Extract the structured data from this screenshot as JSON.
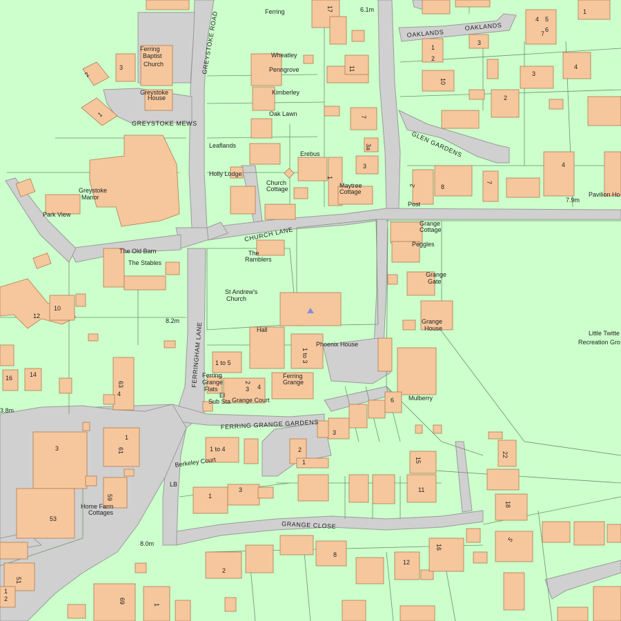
{
  "map": {
    "colors": {
      "land": "#ccffcc",
      "road": "#d0d0d0",
      "road_edge": "#9a9a9a",
      "building": "#f6c79d",
      "building_edge": "#b07a50",
      "boundary": "#6f8f6f",
      "church_marker": "#7f8fe0"
    },
    "roads": {
      "greystoke_road": "GREYSTOKE ROAD",
      "greystoke_mews": "GREYSTOKE MEWS",
      "church_lane": "CHURCH LANE",
      "ferringham_lane": "FERRINGHAM LANE",
      "ferring_grange_gardens": "FERRING GRANGE GARDENS",
      "grange_close": "GRANGE CLOSE",
      "glen_gardens": "GLEN GARDENS",
      "oaklands_1": "OAKLANDS",
      "oaklands_2": "OAKLANDS"
    },
    "places": {
      "ferring": "Ferring",
      "baptist_1": "Ferring",
      "baptist_2": "Baptist",
      "baptist_3": "Church",
      "greystoke_house_1": "Greystoke",
      "greystoke_house_2": "House",
      "wheatley": "Wheatley",
      "penngrove": "Penngrove",
      "kimberley": "Kimberley",
      "oak_lawn": "Oak Lawn",
      "leaflands": "Leaflands",
      "erebus": "Erebus",
      "holly_lodge": "Holly Lodge",
      "church_cottage_1": "Church",
      "church_cottage_2": "Cottage",
      "maytree_1": "Maytree",
      "maytree_2": "Cottage",
      "greystoke_manor_1": "Greystoke",
      "greystoke_manor_2": "Manor",
      "park_view": "Park View",
      "the_old_barn": "The Old Barn",
      "the_stables": "The Stables",
      "the_ramblers_1": "The",
      "the_ramblers_2": "Ramblers",
      "st_andrews_1": "St Andrew's",
      "st_andrews_2": "Church",
      "hall": "Hall",
      "phoenix_house": "Phoenix House",
      "grange_cottage_1": "Grange",
      "grange_cottage_2": "Cottage",
      "peggles": "Peggles",
      "grange_gate_1": "Grange",
      "grange_gate_2": "Gate",
      "grange_house_1": "Grange",
      "grange_house_2": "House",
      "post": "Post",
      "pavilion": "Pavilion Ho",
      "little_twitten_1": "Little Twitte",
      "little_twitten_2": "Recreation Gro",
      "ferring_grange_flats_1": "Ferring",
      "ferring_grange_flats_2": "Grange",
      "ferring_grange_flats_3": "Flats",
      "el_sub_sta_1": "El",
      "el_sub_sta_2": "Sub Sta",
      "grange_court": "Grange Court",
      "ferring_grange_1": "Ferring",
      "ferring_grange_2": "Grange",
      "mulberry": "Mulberry",
      "berkeley_court": "Berkeley Court",
      "lb": "LB",
      "home_farm_1": "Home Farm",
      "home_farm_2": "Cottages"
    },
    "spot_heights": {
      "h1": "6.1m",
      "h2": "8.2m",
      "h3": "7.9m",
      "h4": "8.0m",
      "h5": "3.8m"
    },
    "numbers": {
      "n17": "17",
      "n1_topright": "1",
      "n5": "5",
      "n4": "4",
      "n6": "6",
      "n7": "7",
      "n3_greystoke": "3",
      "n2_left": "2",
      "n1_mews": "1",
      "n11": "11",
      "n1_oaklands": "1",
      "n2_oaklands": "2",
      "n3_oaklands": "3",
      "n4_east": "4",
      "n10_east": "10",
      "n3_east": "3",
      "n2_east": "2",
      "n7_north": "7",
      "n3a": "3a",
      "n3_maytree": "3",
      "n1_maytree": "1",
      "n4_glen": "4",
      "n8_glen": "8",
      "n7_glen": "7",
      "n2_glen": "2",
      "n10_west": "10",
      "n12_west": "12",
      "n1to5": "1 to 5",
      "n1to3": "1 to 3",
      "n2_gc": "2",
      "n3_gc": "3",
      "n4_gc": "4",
      "n6_fg": "6",
      "n3_fgg": "3",
      "n16_w": "16",
      "n14_w": "14",
      "n63": "63",
      "n4_w": "4",
      "n3_big": "3",
      "n61": "61",
      "n1_block": "1",
      "n1to4": "1 to 4",
      "n59": "59",
      "n53": "53",
      "n1_bc": "1",
      "n3_bc": "3",
      "n2_fgg": "2",
      "n1_fgg": "1",
      "n15": "15",
      "n11_s": "11",
      "n22": "22",
      "n18": "18",
      "n16_s": "16",
      "n5_s": "5",
      "n8_s": "8",
      "n12_s": "12",
      "n2_s": "2",
      "n1_sw": "1",
      "n2_sw": "2",
      "n51": "51",
      "n69": "69",
      "n1_sw2": "1"
    }
  }
}
